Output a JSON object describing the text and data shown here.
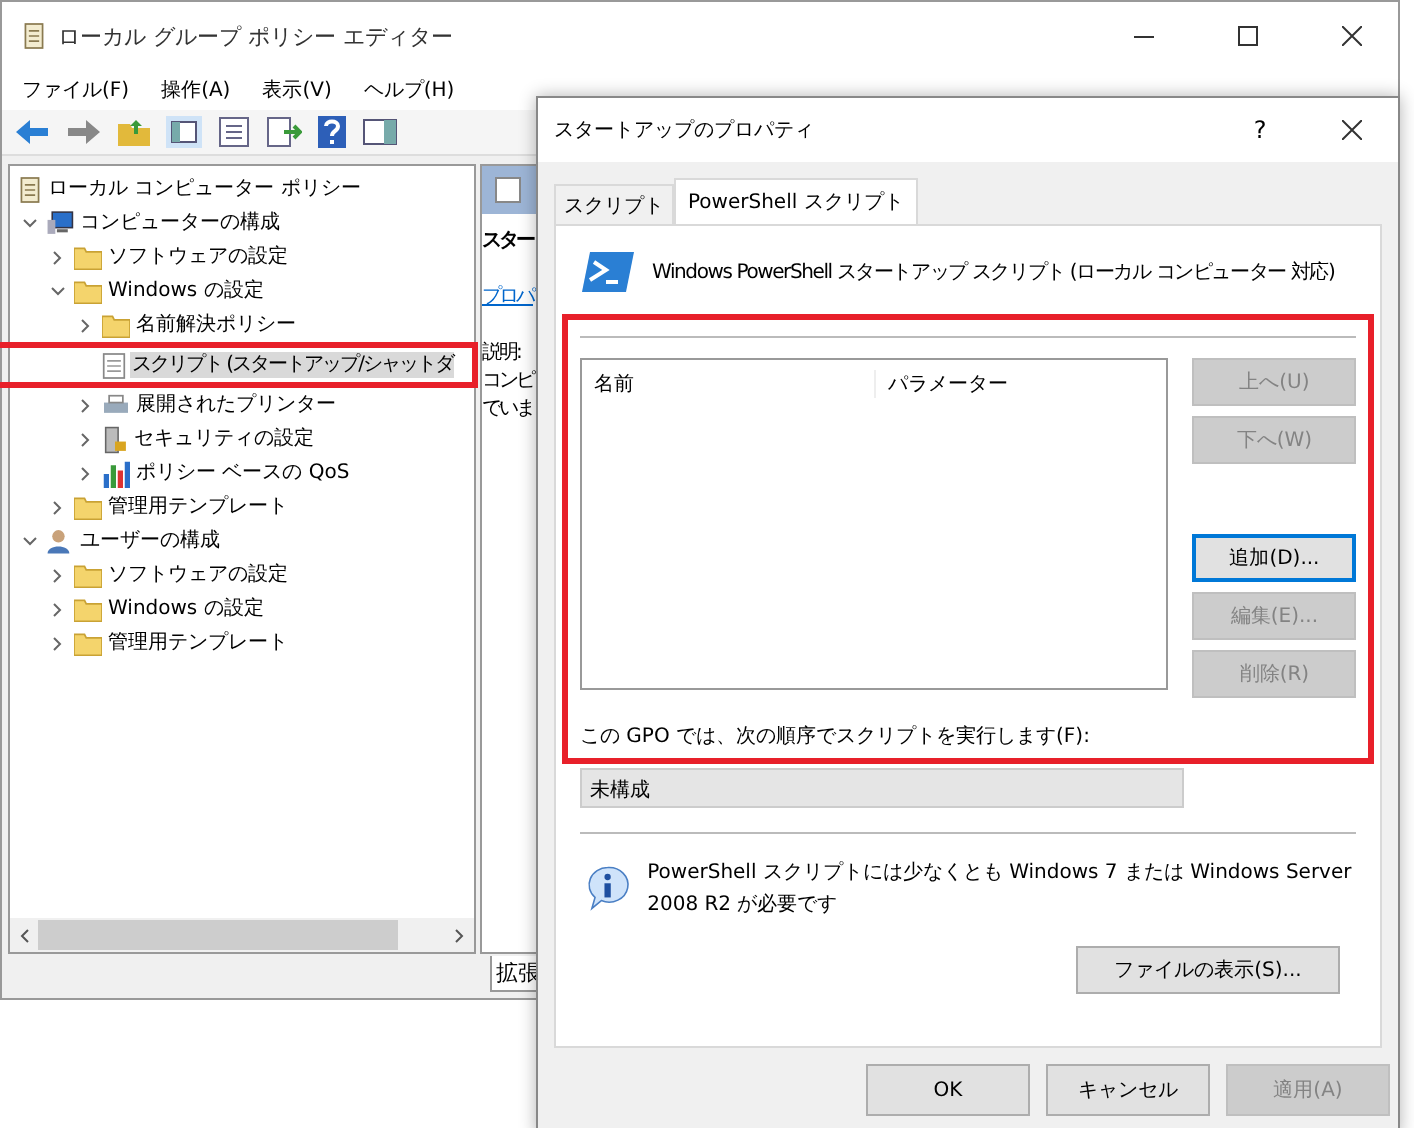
{
  "main_window": {
    "title": "ローカル グループ ポリシー エディター",
    "menu": [
      "ファイル(F)",
      "操作(A)",
      "表示(V)",
      "ヘルプ(H)"
    ],
    "tree": [
      {
        "label": "ローカル コンピューター ポリシー",
        "kind": "policy",
        "selected": false,
        "children": [
          {
            "label": "コンピューターの構成",
            "kind": "computer",
            "expanded": true,
            "selected": false,
            "children": [
              {
                "label": "ソフトウェアの設定",
                "kind": "folder",
                "expanded": false,
                "selected": false
              },
              {
                "label": "Windows の設定",
                "kind": "folder",
                "expanded": true,
                "selected": false,
                "children": [
                  {
                    "label": "名前解決ポリシー",
                    "kind": "folder",
                    "expanded": false,
                    "selected": false
                  },
                  {
                    "label": "スクリプト (スタートアップ/シャットダ",
                    "kind": "script",
                    "selected": true
                  },
                  {
                    "label": "展開されたプリンター",
                    "kind": "printer",
                    "expanded": false,
                    "selected": false
                  },
                  {
                    "label": "セキュリティの設定",
                    "kind": "security",
                    "expanded": false,
                    "selected": false
                  },
                  {
                    "label": "ポリシー ベースの QoS",
                    "kind": "chart",
                    "expanded": false,
                    "selected": false
                  }
                ]
              },
              {
                "label": "管理用テンプレート",
                "kind": "folder",
                "expanded": false,
                "selected": false
              }
            ]
          },
          {
            "label": "ユーザーの構成",
            "kind": "user",
            "expanded": true,
            "selected": false,
            "children": [
              {
                "label": "ソフトウェアの設定",
                "kind": "folder",
                "expanded": false,
                "selected": false
              },
              {
                "label": "Windows の設定",
                "kind": "folder",
                "expanded": false,
                "selected": false
              },
              {
                "label": "管理用テンプレート",
                "kind": "folder",
                "expanded": false,
                "selected": false
              }
            ]
          }
        ]
      }
    ],
    "right_pane": {
      "heading": "スター",
      "link": "プロパ",
      "description": [
        "説明:",
        "コンピ",
        "でいま"
      ]
    },
    "bottom_tab": "拡張"
  },
  "dialog": {
    "title": "スタートアップのプロパティ",
    "help": "?",
    "tabs": [
      {
        "label": "スクリプト",
        "selected": false
      },
      {
        "label": "PowerShell スクリプト",
        "selected": true
      }
    ],
    "header": "Windows PowerShell スタートアップ スクリプト (ローカル コンピューター 対応)",
    "columns": [
      "名前",
      "パラメーター"
    ],
    "move_buttons": [
      {
        "label": "上へ(U)",
        "disabled": true,
        "focused": false
      },
      {
        "label": "下へ(W)",
        "disabled": true,
        "focused": false
      }
    ],
    "edit_buttons": [
      {
        "label": "追加(D)...",
        "disabled": false,
        "focused": true
      },
      {
        "label": "編集(E)...",
        "disabled": true,
        "focused": false
      },
      {
        "label": "削除(R)",
        "disabled": true,
        "focused": false
      }
    ],
    "order_label": "この GPO では、次の順序でスクリプトを実行します(F):",
    "order_value": "未構成",
    "info": "PowerShell スクリプトには少なくとも Windows 7 または Windows Server 2008 R2 が必要です",
    "file_button": "ファイルの表示(S)...",
    "footer_buttons": [
      {
        "label": "OK",
        "disabled": false
      },
      {
        "label": "キャンセル",
        "disabled": false
      },
      {
        "label": "適用(A)",
        "disabled": true
      }
    ]
  }
}
